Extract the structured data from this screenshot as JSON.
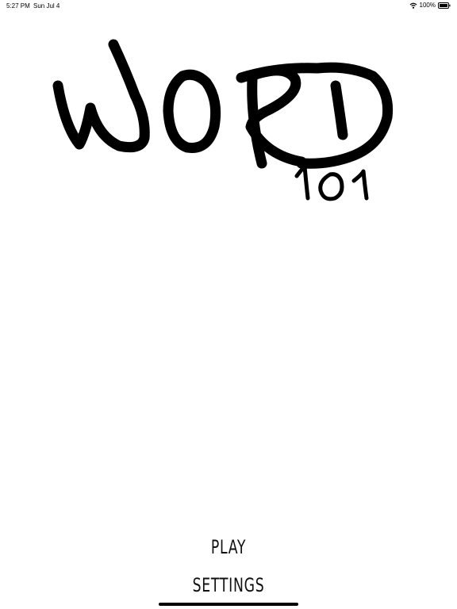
{
  "status_bar": {
    "time": "5:27 PM",
    "date": "Sun Jul 4",
    "battery": "100%",
    "wifi_icon": "wifi-icon",
    "battery_icon": "battery-icon"
  },
  "logo": {
    "word": "WORD",
    "number": "101",
    "style": "hand-drawn"
  },
  "menu": {
    "play_label": "PLAY",
    "settings_label": "SETTINGS"
  },
  "colors": {
    "background": "#ffffff",
    "ink": "#000000"
  }
}
